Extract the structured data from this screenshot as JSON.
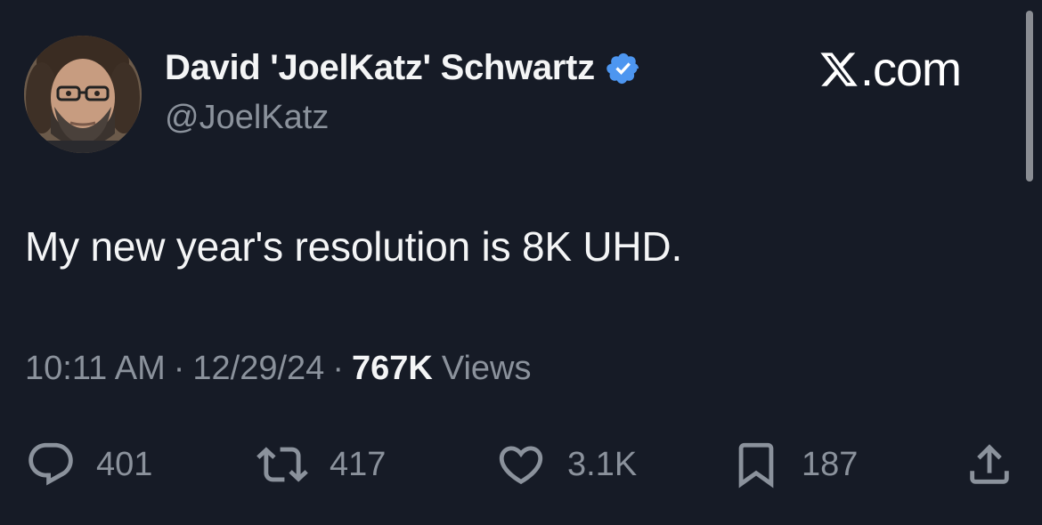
{
  "author": {
    "display_name": "David 'JoelKatz' Schwartz",
    "handle": "@JoelKatz",
    "verified": true,
    "avatar": "profile-photo"
  },
  "brand": {
    "text": ".com"
  },
  "tweet": {
    "text": "My new year's resolution is 8K UHD."
  },
  "meta": {
    "time": "10:11 AM",
    "separator": "·",
    "date": "12/29/24",
    "views_count": "767K",
    "views_label": "Views"
  },
  "actions": {
    "replies": "401",
    "reposts": "417",
    "likes": "3.1K",
    "bookmarks": "187"
  },
  "colors": {
    "background": "#161b26",
    "primary_text": "#f4f5f6",
    "secondary_text": "#8b929c",
    "verified_badge": "#4d96f0"
  }
}
